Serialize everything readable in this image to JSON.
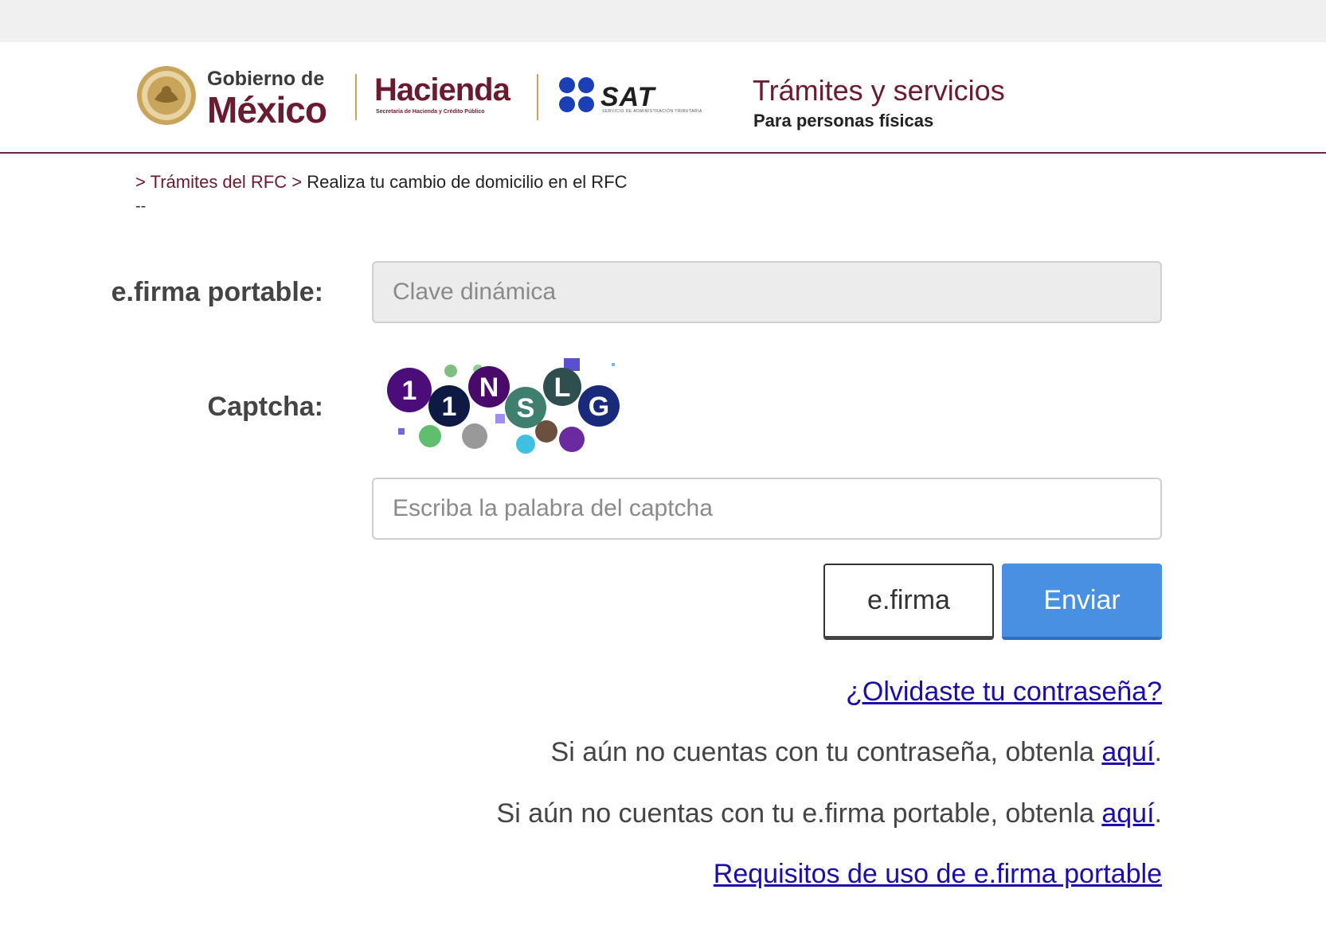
{
  "header": {
    "gob_small": "Gobierno de",
    "gob_big": "México",
    "hacienda": "Hacienda",
    "hacienda_sub": "Secretaría de Hacienda y Crédito Público",
    "sat": "SAT",
    "sat_sub": "SERVICIO DE ADMINISTRACIÓN TRIBUTARIA",
    "title": "Trámites y servicios",
    "subtitle": "Para personas físicas"
  },
  "breadcrumb": {
    "sep": ">",
    "link": "Trámites del RFC",
    "current": "Realiza tu cambio de domicilio en el RFC",
    "trailer": "--"
  },
  "form": {
    "efirma_label": "e.firma portable:",
    "clave_placeholder": "Clave dinámica",
    "captcha_label": "Captcha:",
    "captcha_placeholder": "Escriba la palabra del captcha",
    "captcha_chars": [
      "1",
      "1",
      "N",
      "S",
      "L",
      "G"
    ]
  },
  "buttons": {
    "efirma": "e.firma",
    "enviar": "Enviar"
  },
  "links": {
    "olvidaste": "¿Olvidaste tu contraseña?",
    "contra_text": "Si aún no cuentas con tu contraseña, obtenla ",
    "contra_link": "aquí",
    "efirma_text": "Si aún no cuentas con tu e.firma portable, obtenla ",
    "efirma_link": "aquí",
    "period": ".",
    "requisitos": "Requisitos de uso de e.firma portable"
  },
  "colors": {
    "brand": "#6b1b30",
    "accent_gold": "#c9a55c",
    "primary_button": "#4a90e2",
    "link": "#1a0dab",
    "sat_blue": "#1b3fb7"
  }
}
